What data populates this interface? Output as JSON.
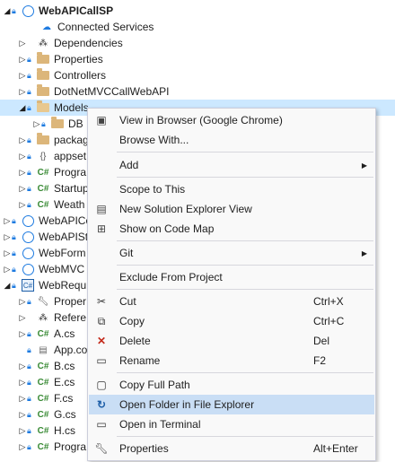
{
  "tree": {
    "solution": "WebAPICallSP",
    "items": [
      {
        "label": "Connected Services"
      },
      {
        "label": "Dependencies"
      },
      {
        "label": "Properties"
      },
      {
        "label": "Controllers"
      },
      {
        "label": "DotNetMVCCallWebAPI"
      },
      {
        "label": "Models"
      },
      {
        "label": "DB"
      },
      {
        "label": "packag"
      },
      {
        "label": "appset"
      },
      {
        "label": "Progra"
      },
      {
        "label": "Startup"
      },
      {
        "label": "Weath"
      },
      {
        "label": "WebAPICo"
      },
      {
        "label": "WebAPISt"
      },
      {
        "label": "WebForm"
      },
      {
        "label": "WebMVC"
      },
      {
        "label": "WebRequ"
      },
      {
        "label": "Proper"
      },
      {
        "label": "Refere"
      },
      {
        "label": "A.cs"
      },
      {
        "label": "App.co"
      },
      {
        "label": "B.cs"
      },
      {
        "label": "E.cs"
      },
      {
        "label": "F.cs"
      },
      {
        "label": "G.cs"
      },
      {
        "label": "H.cs"
      },
      {
        "label": "Progra"
      }
    ]
  },
  "menu": {
    "items": [
      {
        "label": "View in Browser (Google Chrome)",
        "icon": "browser-icon"
      },
      {
        "label": "Browse With...",
        "icon": ""
      },
      {
        "label": "Add",
        "icon": ""
      },
      {
        "label": "Scope to This",
        "icon": ""
      },
      {
        "label": "New Solution Explorer View",
        "icon": "solution-explorer-icon"
      },
      {
        "label": "Show on Code Map",
        "icon": "code-map-icon"
      },
      {
        "label": "Git",
        "icon": ""
      },
      {
        "label": "Exclude From Project",
        "icon": ""
      },
      {
        "label": "Cut",
        "icon": "cut-icon",
        "shortcut": "Ctrl+X"
      },
      {
        "label": "Copy",
        "icon": "copy-icon",
        "shortcut": "Ctrl+C"
      },
      {
        "label": "Delete",
        "icon": "delete-icon",
        "shortcut": "Del"
      },
      {
        "label": "Rename",
        "icon": "rename-icon",
        "shortcut": "F2"
      },
      {
        "label": "Copy Full Path",
        "icon": "copy-path-icon"
      },
      {
        "label": "Open Folder in File Explorer",
        "icon": "open-folder-icon"
      },
      {
        "label": "Open in Terminal",
        "icon": "terminal-icon"
      },
      {
        "label": "Properties",
        "icon": "properties-wrench-icon",
        "shortcut": "Alt+Enter"
      }
    ]
  },
  "colors": {
    "selection": "#cce8ff",
    "menu_highlight": "#c9def5",
    "folder": "#dcb67a",
    "csharp": "#388a34",
    "delete": "#c42b1c"
  }
}
